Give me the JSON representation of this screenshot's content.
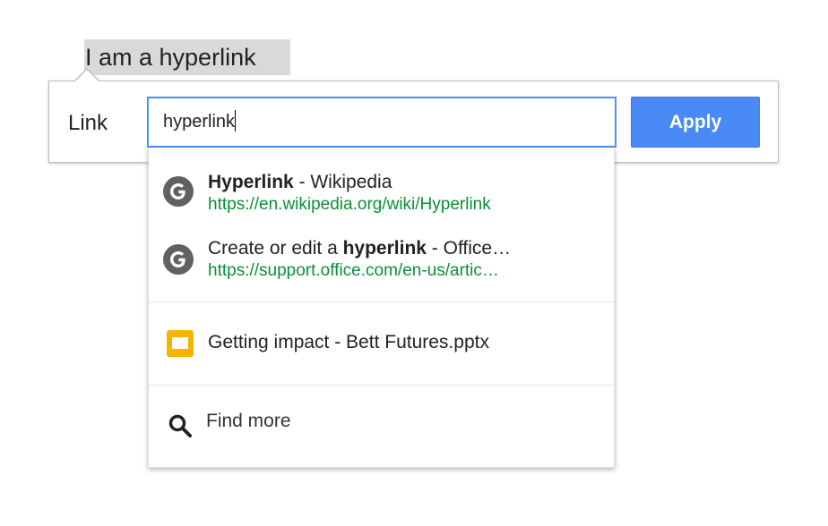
{
  "document": {
    "selected_text": "I am a hyperlink"
  },
  "link_bubble": {
    "label": "Link",
    "input_value": "hyperlink",
    "apply_label": "Apply"
  },
  "suggestions": [
    {
      "icon": "google-g-icon",
      "title_bold": "Hyperlink",
      "title_rest": " - Wikipedia",
      "url": "https://en.wikipedia.org/wiki/Hyperlink"
    },
    {
      "icon": "google-g-icon",
      "title_prefix": "Create or edit a ",
      "title_bold": "hyperlink",
      "title_rest": " - Office…",
      "url": "https://support.office.com/en-us/artic…"
    }
  ],
  "file_result": {
    "icon": "slides-icon",
    "title": "Getting impact - Bett Futures.pptx"
  },
  "find_more": {
    "icon": "search-icon",
    "label": "Find more"
  },
  "colors": {
    "accent": "#4a8af4",
    "url_green": "#0b8f37",
    "slides_yellow": "#f4b400",
    "icon_gray": "#616161"
  }
}
